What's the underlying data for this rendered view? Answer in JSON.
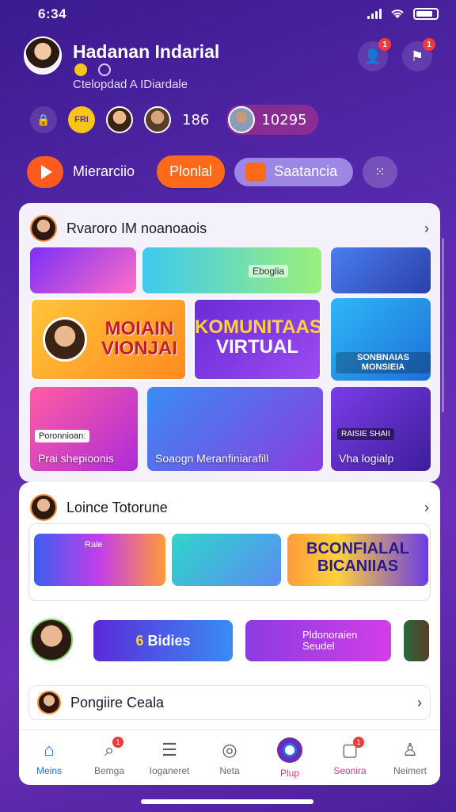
{
  "status": {
    "time": "6:34"
  },
  "profile": {
    "name": "Hadanan Indarial",
    "subtitle": "Ctelopdad A IDiardale"
  },
  "header": {
    "notif_count": "1",
    "alerts_count": "1"
  },
  "stats": {
    "count": "186",
    "score": "10295",
    "gold_label": "FRI"
  },
  "actions": {
    "play_label": "Mierarciio",
    "primary_label": "Plonlal",
    "secondary_label": "Saatancia"
  },
  "feed": {
    "title": "Rvaroro IM noanoaois",
    "tiles": {
      "t2_tag": "Eboglia",
      "t4_text": [
        "MOIAIN",
        "VIONJAI"
      ],
      "t5_text": [
        "KOMUNITAAS",
        "VIRTUAL"
      ],
      "t6_text": "SONBNAIAS MONSIEIA",
      "t7_tag": "Poronnioan:",
      "t7_label": "Prai shepioonis",
      "t8_label": "Soaogn Meranfiniarafill",
      "t9_tag": "RAISIE SHAII",
      "t9_label": "Vha logialp"
    }
  },
  "section2": {
    "title": "Loince Totorune",
    "strip": {
      "st1_tag": "Raie",
      "st3_text": [
        "BCONFIALAL",
        "BICANIIAS"
      ]
    },
    "row2": {
      "btn1_num": "6",
      "btn1_text": "Bidies",
      "btn2_text": "Pldonoraien Seudel"
    },
    "row3_title": "Pongiire Ceala"
  },
  "nav": [
    {
      "label": "Meins",
      "icon": "home-icon"
    },
    {
      "label": "Bemga",
      "icon": "search-icon",
      "badge": "1"
    },
    {
      "label": "Ioganeret",
      "icon": "notes-icon"
    },
    {
      "label": "Neta",
      "icon": "explore-icon"
    },
    {
      "label": "Plup",
      "icon": "center-play-icon"
    },
    {
      "label": "Seonira",
      "icon": "inbox-icon",
      "badge": "1"
    },
    {
      "label": "Neimert",
      "icon": "profile-icon"
    }
  ],
  "colors": {
    "accent": "#ff6a1a",
    "brand": "#5a2bb0",
    "nav_active": "#1e6fe8"
  }
}
